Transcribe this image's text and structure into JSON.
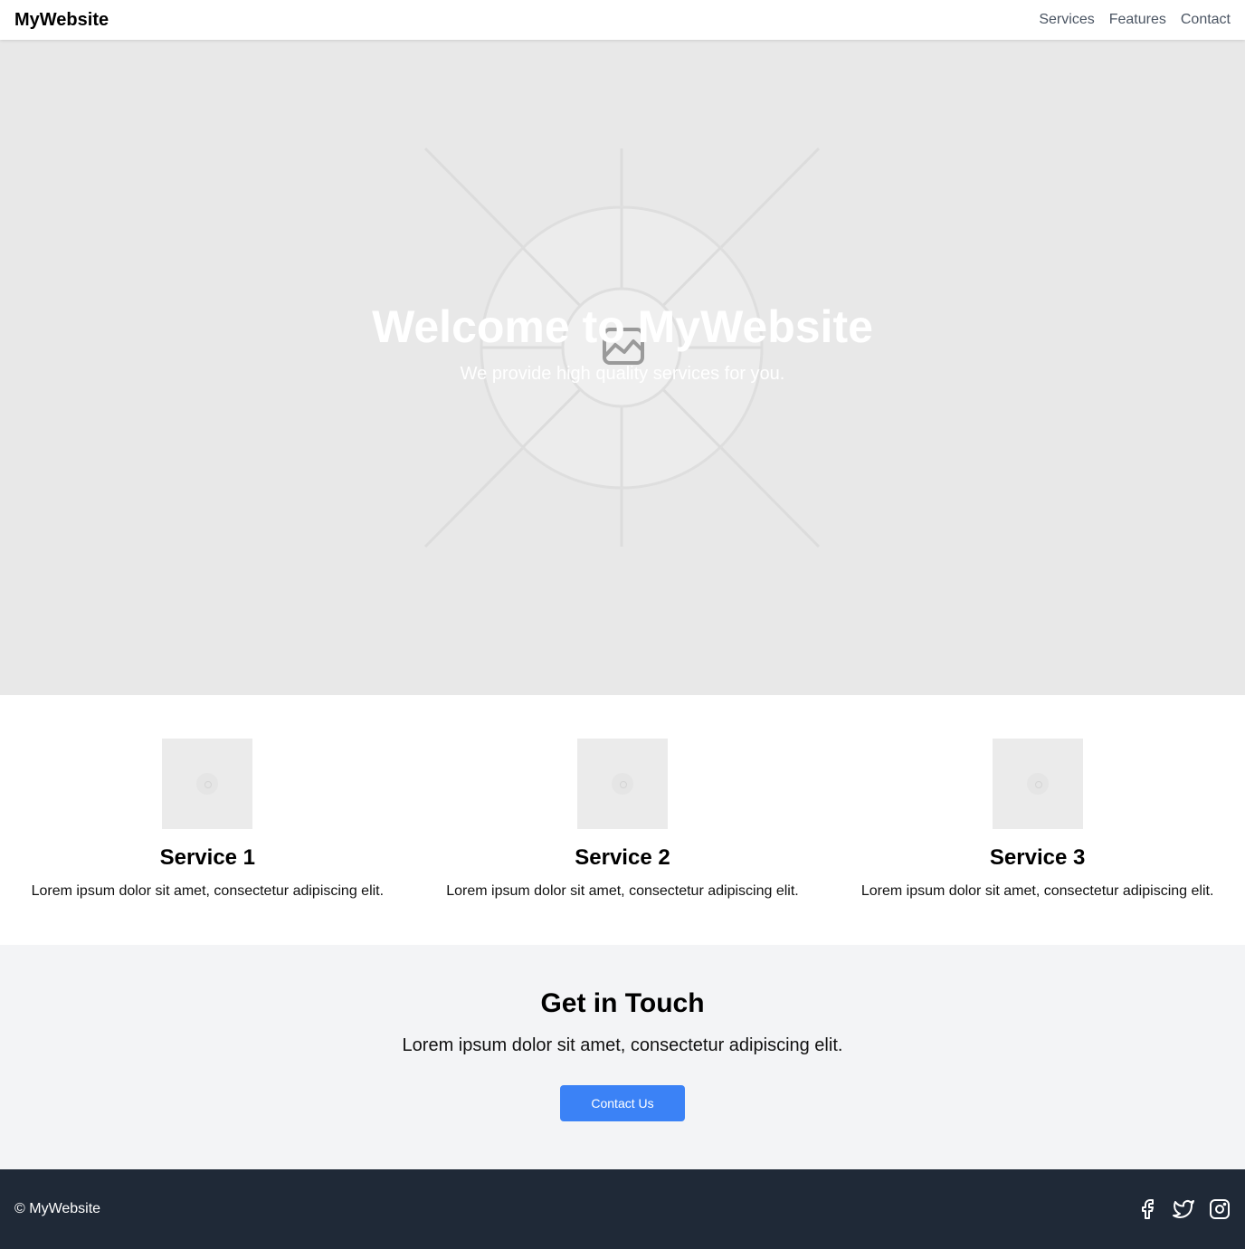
{
  "nav": {
    "brand": "MyWebsite",
    "links": [
      "Services",
      "Features",
      "Contact"
    ]
  },
  "hero": {
    "title": "Welcome to MyWebsite",
    "subtitle": "We provide high quality services for you.",
    "image_icon": "image-placeholder-icon"
  },
  "services": [
    {
      "title": "Service 1",
      "description": "Lorem ipsum dolor sit amet, consectetur adipiscing elit."
    },
    {
      "title": "Service 2",
      "description": "Lorem ipsum dolor sit amet, consectetur adipiscing elit."
    },
    {
      "title": "Service 3",
      "description": "Lorem ipsum dolor sit amet, consectetur adipiscing elit."
    }
  ],
  "contact": {
    "title": "Get in Touch",
    "description": "Lorem ipsum dolor sit amet, consectetur adipiscing elit.",
    "button_label": "Contact Us"
  },
  "footer": {
    "copyright": "© MyWebsite",
    "social_icons": [
      "facebook-icon",
      "twitter-icon",
      "instagram-icon"
    ]
  },
  "colors": {
    "accent": "#3b82f6",
    "footer_bg": "#1f2937",
    "contact_bg": "#f3f4f6",
    "hero_bg": "#e8e8e8"
  }
}
